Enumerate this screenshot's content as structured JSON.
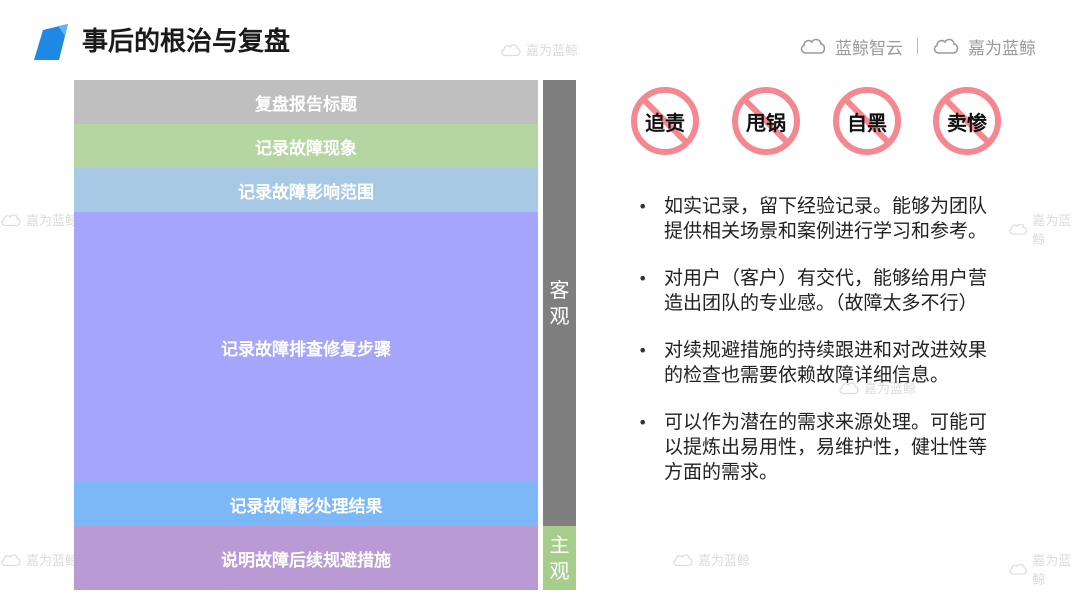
{
  "header": {
    "title": "事后的根治与复盘",
    "brand_primary": "蓝鲸智云",
    "brand_secondary": "嘉为蓝鲸",
    "logo_icon": "parallelogram-logo-icon",
    "accent_color": "#1e88e5"
  },
  "watermark": {
    "text": "嘉为蓝鲸",
    "icon": "cloud-icon"
  },
  "report_sections": [
    {
      "label": "复盘报告标题",
      "color": "#bfbfbf"
    },
    {
      "label": "记录故障现象",
      "color": "#b5d6a1"
    },
    {
      "label": "记录故障影响范围",
      "color": "#a7c9e6"
    },
    {
      "label": "记录故障排查修复步骤",
      "color": "#a5a6fb"
    },
    {
      "label": "记录故障影处理结果",
      "color": "#7cb8f7"
    },
    {
      "label": "说明故障后续规避措施",
      "color": "#b99ad5"
    }
  ],
  "side_labels": {
    "objective": {
      "text": "客观",
      "color": "#7f7f7f"
    },
    "subjective": {
      "text": "主观",
      "color": "#a7cd8c"
    }
  },
  "prohibited": [
    {
      "label": "追责",
      "icon": "prohibited-icon"
    },
    {
      "label": "甩锅",
      "icon": "prohibited-icon"
    },
    {
      "label": "自黑",
      "icon": "prohibited-icon"
    },
    {
      "label": "卖惨",
      "icon": "prohibited-icon"
    }
  ],
  "prohibited_color": "#f4878f",
  "bullets": [
    "如实记录，留下经验记录。能够为团队提供相关场景和案例进行学习和参考。",
    "对用户（客户）有交代，能够给用户营造出团队的专业感。（故障太多不行）",
    "对续规避措施的持续跟进和对改进效果的检查也需要依赖故障详细信息。",
    "可以作为潜在的需求来源处理。可能可以提炼出易用性，易维护性，健壮性等方面的需求。"
  ]
}
